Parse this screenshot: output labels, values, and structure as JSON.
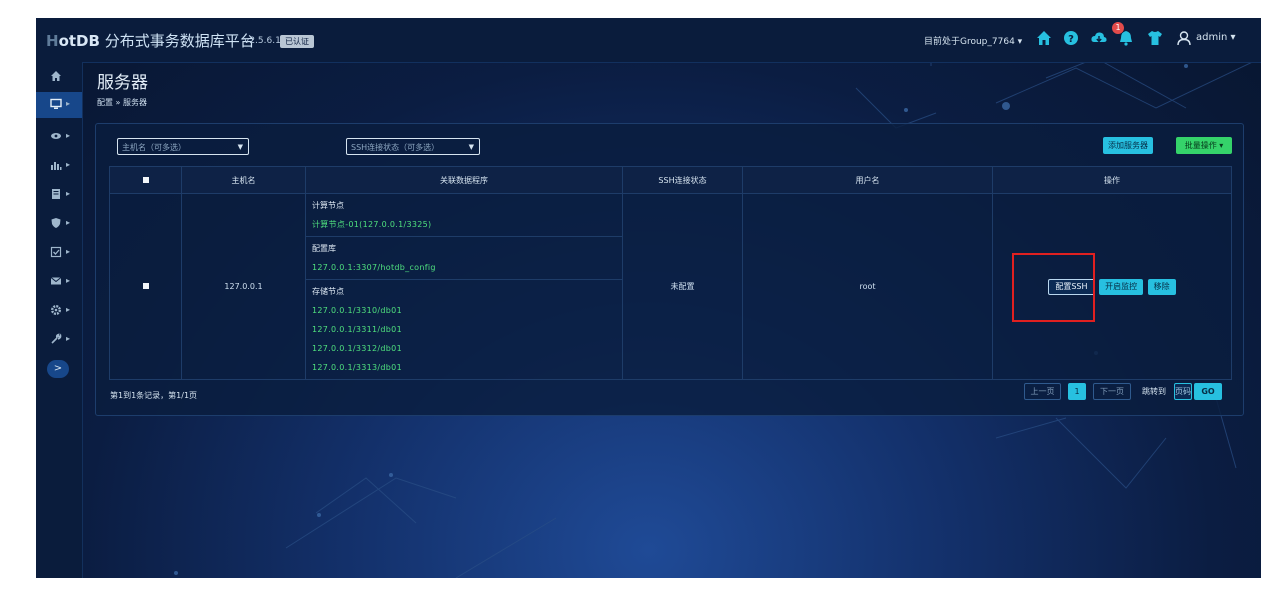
{
  "app": {
    "logo_prefix": "H",
    "logo_rest": "otDB",
    "name": "分布式事务数据库平台",
    "version": "v2.5.6.1",
    "cert_badge": "已认证"
  },
  "topbar": {
    "group_select": "目前处于Group_7764 ▾",
    "notification_count": "1",
    "user": "admin ▾"
  },
  "sidebar": {
    "items": [
      "home",
      "server",
      "monitor",
      "chart",
      "list",
      "shield",
      "check",
      "mail",
      "gear",
      "wrench"
    ],
    "active_index": 1,
    "toggle": ">"
  },
  "page": {
    "title": "服务器",
    "breadcrumb_root": "配置",
    "breadcrumb_sep": "»",
    "breadcrumb_current": "服务器"
  },
  "filters": {
    "host": "主机名（可多选）",
    "ssh_status": "SSH连接状态（可多选）"
  },
  "toolbar": {
    "add_label": "添加服务器",
    "batch_label": "批量操作 ▾"
  },
  "table": {
    "headers": [
      "",
      "主机名",
      "关联数据程序",
      "SSH连接状态",
      "用户名",
      "操作"
    ],
    "rows": [
      {
        "host": "127.0.0.1",
        "relations": [
          {
            "title": "计算节点",
            "items": [
              "计算节点-01(127.0.0.1/3325)"
            ]
          },
          {
            "title": "配置库",
            "items": [
              "127.0.0.1:3307/hotdb_config"
            ]
          },
          {
            "title": "存储节点",
            "items": [
              "127.0.0.1/3310/db01",
              "127.0.0.1/3311/db01",
              "127.0.0.1/3312/db01",
              "127.0.0.1/3313/db01"
            ]
          }
        ],
        "ssh_status": "未配置",
        "username": "root",
        "actions": {
          "config_ssh": "配置SSH",
          "monitor": "开启监控",
          "remove": "移除"
        }
      }
    ]
  },
  "pagination": {
    "record_info": "第1到1条记录，第1/1页",
    "prev": "上一页",
    "current": "1",
    "next": "下一页",
    "jump_label": "跳转到",
    "page_input_placeholder": "页码",
    "go": "GO"
  },
  "colors": {
    "accent_cyan": "#27c0e0",
    "accent_green": "#35d36a",
    "link_green": "#4fe07e",
    "highlight_red": "#e02020",
    "badge_red": "#e14b4b"
  }
}
